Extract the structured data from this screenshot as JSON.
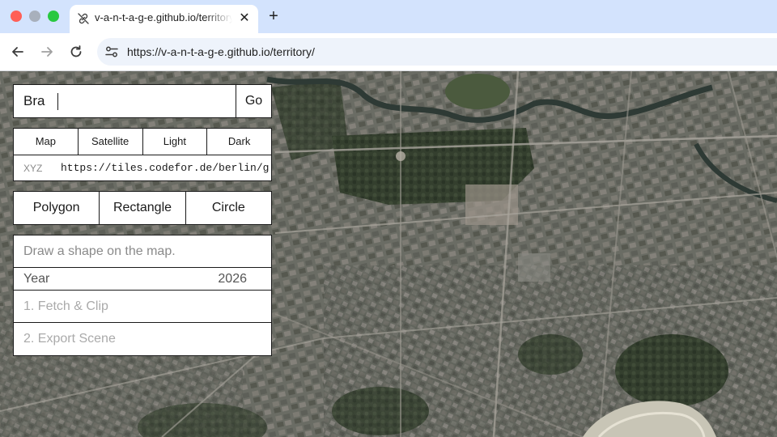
{
  "browser": {
    "tab_title": "v-a-n-t-a-g-e.github.io/territory/",
    "tab_icon": "link-icon",
    "url": "https://v-a-n-t-a-g-e.github.io/territory/"
  },
  "search": {
    "value": "Bra",
    "go_label": "Go"
  },
  "layers": {
    "tabs": [
      "Map",
      "Satellite",
      "Light",
      "Dark"
    ],
    "xyz_label": "XYZ",
    "xyz_url": "https://tiles.codefor.de/berlin/geo"
  },
  "shapes": {
    "buttons": [
      "Polygon",
      "Rectangle",
      "Circle"
    ]
  },
  "panel": {
    "hint": "Draw a shape on the map.",
    "year_label": "Year",
    "year_value": "2026",
    "fetch_label": "1. Fetch & Clip",
    "export_label": "2. Export Scene"
  },
  "map": {
    "style": "satellite imagery"
  }
}
